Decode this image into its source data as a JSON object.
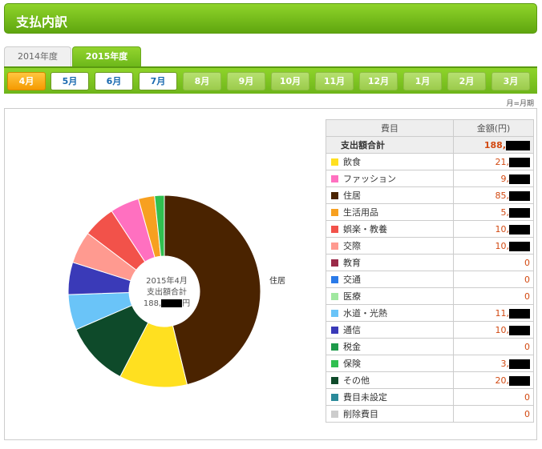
{
  "header": {
    "title": "支払内訳"
  },
  "year_tabs": [
    {
      "label": "2014年度",
      "active": false
    },
    {
      "label": "2015年度",
      "active": true
    }
  ],
  "months": [
    {
      "label": "4月",
      "state": "selected"
    },
    {
      "label": "5月",
      "state": "enabled"
    },
    {
      "label": "6月",
      "state": "enabled"
    },
    {
      "label": "7月",
      "state": "enabled"
    },
    {
      "label": "8月",
      "state": "disabled"
    },
    {
      "label": "9月",
      "state": "disabled"
    },
    {
      "label": "10月",
      "state": "disabled"
    },
    {
      "label": "11月",
      "state": "disabled"
    },
    {
      "label": "12月",
      "state": "disabled"
    },
    {
      "label": "1月",
      "state": "disabled"
    },
    {
      "label": "2月",
      "state": "disabled"
    },
    {
      "label": "3月",
      "state": "disabled"
    }
  ],
  "note": "月=月期",
  "chart": {
    "center_line1": "2015年4月",
    "center_line2": "支出額合計",
    "center_prefix": "188,",
    "center_suffix": "円",
    "slice_label": "住居"
  },
  "table": {
    "col_category": "費目",
    "col_amount": "金額(円)",
    "total_label": "支出額合計",
    "total_amount": "188,",
    "rows": [
      {
        "name": "飲食",
        "amount": "21,",
        "color": "#ffe020",
        "masked": true
      },
      {
        "name": "ファッション",
        "amount": "9,",
        "color": "#ff70c0",
        "masked": true
      },
      {
        "name": "住居",
        "amount": "85,",
        "color": "#4a2300",
        "masked": true
      },
      {
        "name": "生活用品",
        "amount": "5,",
        "color": "#f7a020",
        "masked": true
      },
      {
        "name": "娯楽・教養",
        "amount": "10,",
        "color": "#f2524a",
        "masked": true
      },
      {
        "name": "交際",
        "amount": "10,",
        "color": "#ff9a90",
        "masked": true
      },
      {
        "name": "教育",
        "amount": "0",
        "color": "#9a2a48",
        "masked": false
      },
      {
        "name": "交通",
        "amount": "0",
        "color": "#2a7ae8",
        "masked": false
      },
      {
        "name": "医療",
        "amount": "0",
        "color": "#a0e8a0",
        "masked": false
      },
      {
        "name": "水道・光熱",
        "amount": "11,",
        "color": "#6ac4f8",
        "masked": true
      },
      {
        "name": "通信",
        "amount": "10,",
        "color": "#3a3ab8",
        "masked": true
      },
      {
        "name": "税金",
        "amount": "0",
        "color": "#1e9a4a",
        "masked": false
      },
      {
        "name": "保険",
        "amount": "3,",
        "color": "#30c050",
        "masked": true
      },
      {
        "name": "その他",
        "amount": "20,",
        "color": "#0e4a2a",
        "masked": true
      },
      {
        "name": "費目未設定",
        "amount": "0",
        "color": "#2a8a9a",
        "masked": false
      },
      {
        "name": "削除費目",
        "amount": "0",
        "color": "#cccccc",
        "masked": false
      }
    ]
  },
  "chart_data": {
    "type": "pie",
    "series": [
      {
        "name": "住居",
        "value": 85
      },
      {
        "name": "飲食",
        "value": 21
      },
      {
        "name": "その他",
        "value": 20
      },
      {
        "name": "水道・光熱",
        "value": 11
      },
      {
        "name": "通信",
        "value": 10
      },
      {
        "name": "交際",
        "value": 10
      },
      {
        "name": "娯楽・教養",
        "value": 10
      },
      {
        "name": "ファッション",
        "value": 9
      },
      {
        "name": "生活用品",
        "value": 5
      },
      {
        "name": "保険",
        "value": 3
      }
    ],
    "colors": [
      "#4a2300",
      "#ffe020",
      "#0e4a2a",
      "#6ac4f8",
      "#3a3ab8",
      "#ff9a90",
      "#f2524a",
      "#ff70c0",
      "#f7a020",
      "#30c050"
    ]
  }
}
